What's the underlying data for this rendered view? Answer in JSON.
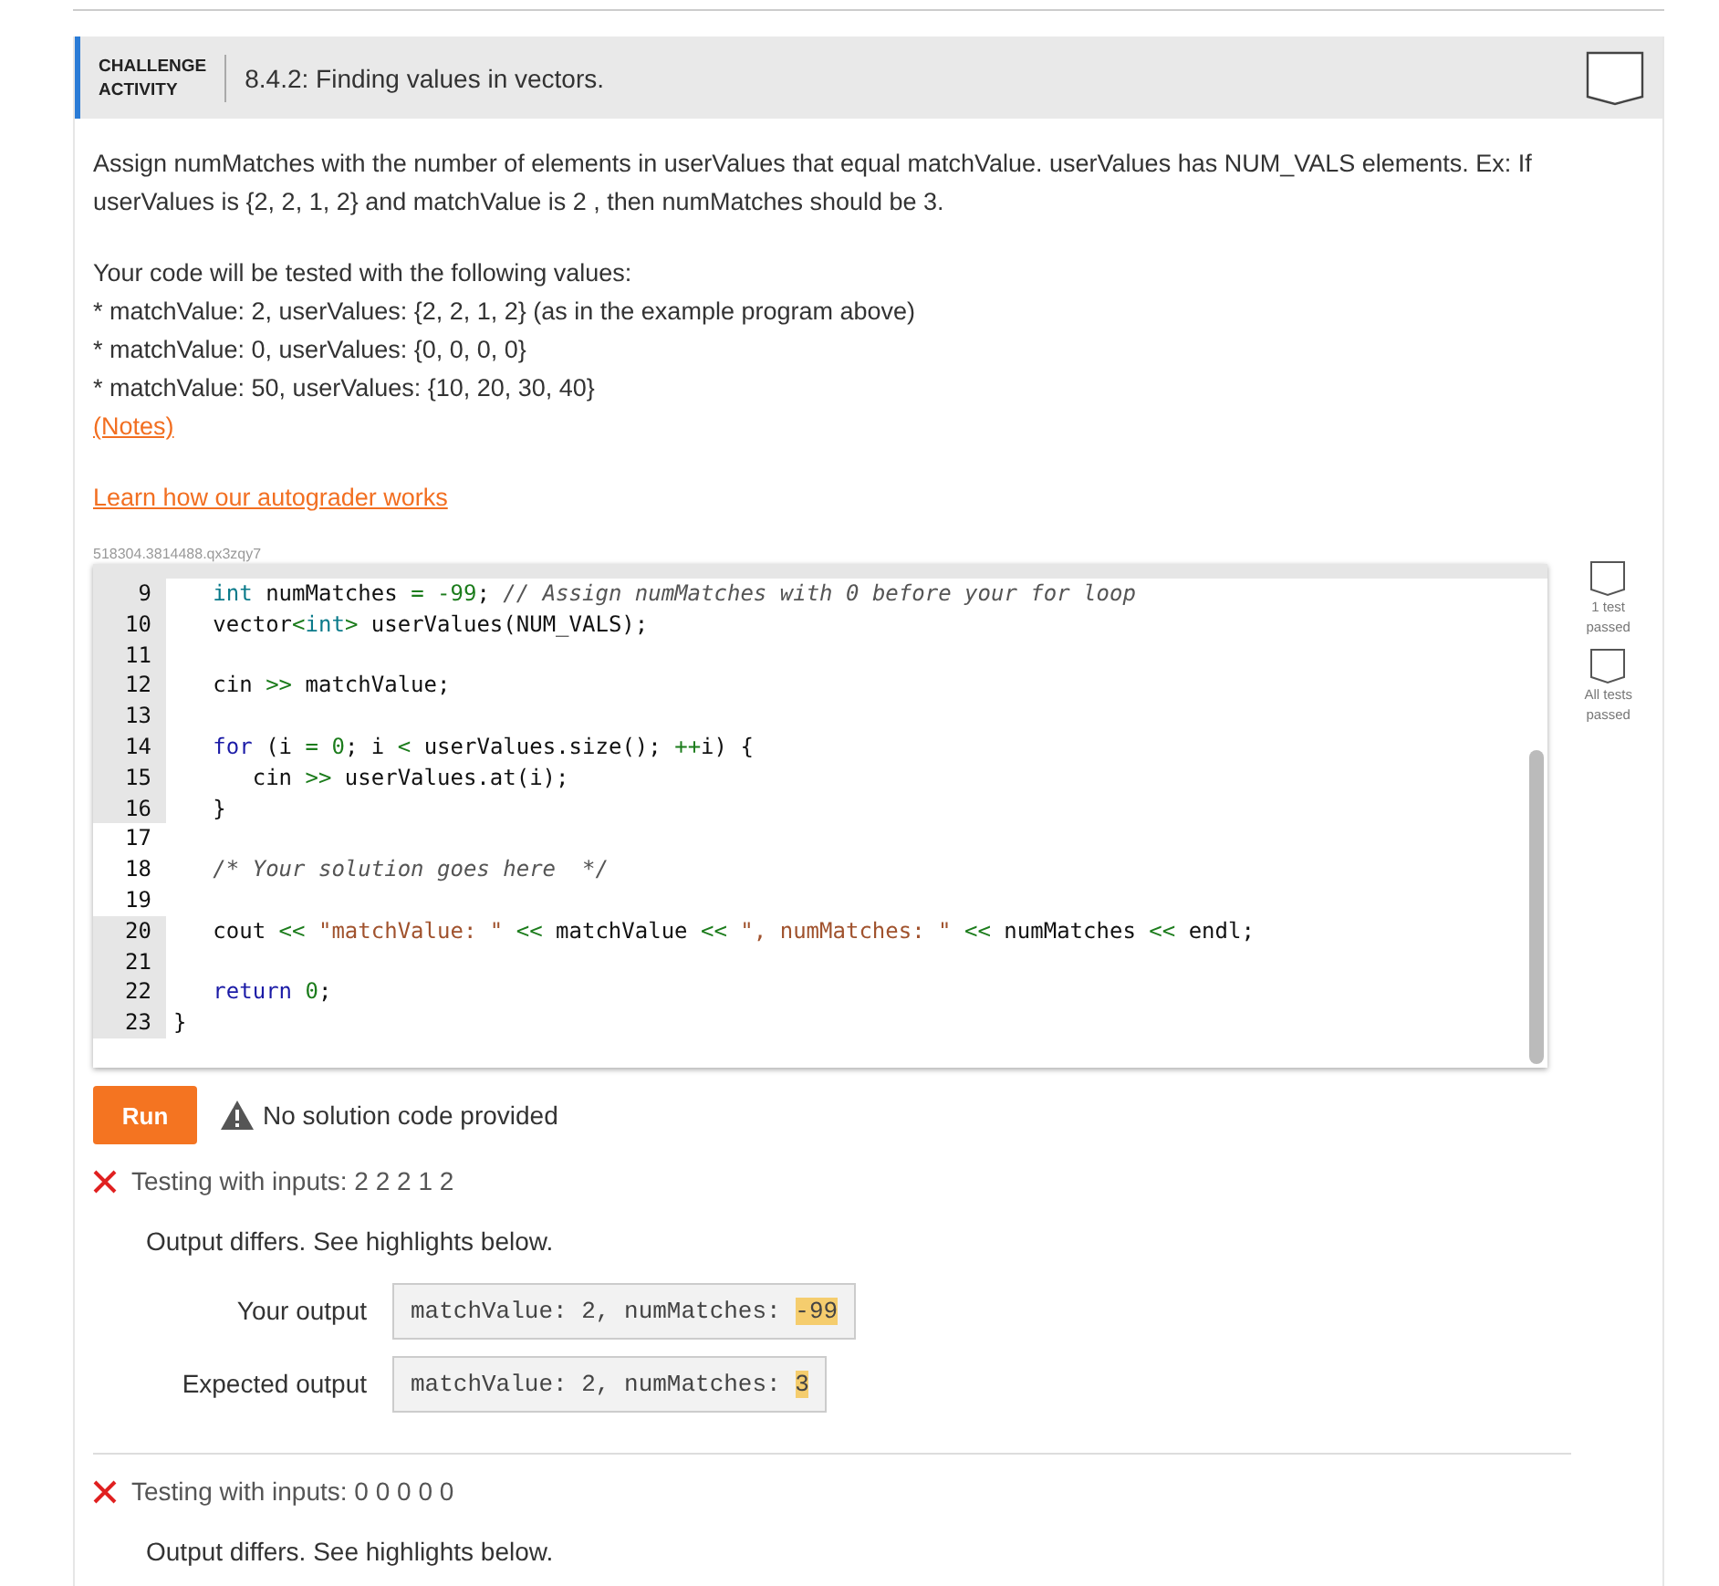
{
  "header": {
    "label_line1": "CHALLENGE",
    "label_line2": "ACTIVITY",
    "title": "8.4.2: Finding values in vectors."
  },
  "instructions": [
    "Assign numMatches with the number of elements in userValues that equal matchValue. userValues has NUM_VALS elements. Ex: If userValues is {2, 2, 1, 2} and matchValue is 2 , then numMatches should be 3."
  ],
  "tests_intro": "Your code will be tested with the following values:",
  "test_values": [
    "* matchValue: 2, userValues: {2, 2, 1, 2} (as in the example program above)",
    "* matchValue: 0, userValues: {0, 0, 0, 0}",
    "* matchValue: 50, userValues: {10, 20, 30, 40}"
  ],
  "notes_link": "(Notes)",
  "autograder_link": "Learn how our autograder works",
  "code_id": "518304.3814488.qx3zqy7",
  "code_lines": [
    {
      "number": "9",
      "editable": false,
      "tokens": [
        {
          "kind": "type",
          "text": "   int"
        },
        {
          "kind": "plain",
          "text": " numMatches "
        },
        {
          "kind": "op",
          "text": "="
        },
        {
          "kind": "number",
          "text": " -99"
        },
        {
          "kind": "plain",
          "text": "; "
        },
        {
          "kind": "comment",
          "text": "// Assign numMatches with 0 before your for loop"
        }
      ]
    },
    {
      "number": "10",
      "editable": false,
      "tokens": [
        {
          "kind": "plain",
          "text": "   vector"
        },
        {
          "kind": "op",
          "text": "<"
        },
        {
          "kind": "type",
          "text": "int"
        },
        {
          "kind": "op",
          "text": ">"
        },
        {
          "kind": "plain",
          "text": " userValues(NUM_VALS);"
        }
      ]
    },
    {
      "number": "11",
      "editable": false
    },
    {
      "number": "12",
      "editable": false,
      "tokens": [
        {
          "kind": "plain",
          "text": "   cin "
        },
        {
          "kind": "op",
          "text": ">>"
        },
        {
          "kind": "plain",
          "text": " matchValue;"
        }
      ]
    },
    {
      "number": "13",
      "editable": false
    },
    {
      "number": "14",
      "editable": false,
      "tokens": [
        {
          "kind": "keyword",
          "text": "   for"
        },
        {
          "kind": "plain",
          "text": " (i "
        },
        {
          "kind": "op",
          "text": "="
        },
        {
          "kind": "number",
          "text": " 0"
        },
        {
          "kind": "plain",
          "text": "; i "
        },
        {
          "kind": "op",
          "text": "<"
        },
        {
          "kind": "plain",
          "text": " userValues.size(); "
        },
        {
          "kind": "op",
          "text": "++"
        },
        {
          "kind": "plain",
          "text": "i) {"
        }
      ]
    },
    {
      "number": "15",
      "editable": false,
      "tokens": [
        {
          "kind": "plain",
          "text": "      cin "
        },
        {
          "kind": "op",
          "text": ">>"
        },
        {
          "kind": "plain",
          "text": " userValues.at(i);"
        }
      ]
    },
    {
      "number": "16",
      "editable": false,
      "tokens": [
        {
          "kind": "plain",
          "text": "   }"
        }
      ]
    },
    {
      "number": "17",
      "editable": true
    },
    {
      "number": "18",
      "editable": true,
      "tokens": [
        {
          "kind": "comment",
          "text": "   /* Your solution goes here  */"
        }
      ]
    },
    {
      "number": "19",
      "editable": true
    },
    {
      "number": "20",
      "editable": false,
      "tokens": [
        {
          "kind": "plain",
          "text": "   cout "
        },
        {
          "kind": "op",
          "text": "<<"
        },
        {
          "kind": "string",
          "text": " \"matchValue: \" "
        },
        {
          "kind": "op",
          "text": "<<"
        },
        {
          "kind": "plain",
          "text": " matchValue "
        },
        {
          "kind": "op",
          "text": "<<"
        },
        {
          "kind": "string",
          "text": " \", numMatches: \" "
        },
        {
          "kind": "op",
          "text": "<<"
        },
        {
          "kind": "plain",
          "text": " numMatches "
        },
        {
          "kind": "op",
          "text": "<<"
        },
        {
          "kind": "plain",
          "text": " endl;"
        }
      ]
    },
    {
      "number": "21",
      "editable": false
    },
    {
      "number": "22",
      "editable": false,
      "tokens": [
        {
          "kind": "keyword",
          "text": "   return"
        },
        {
          "kind": "number",
          "text": " 0"
        },
        {
          "kind": "plain",
          "text": ";"
        }
      ]
    },
    {
      "number": "23",
      "editable": false,
      "tokens": [
        {
          "kind": "plain",
          "text": "}"
        }
      ]
    }
  ],
  "progress": [
    {
      "label": "1 test passed",
      "done": false
    },
    {
      "label": "All tests passed",
      "done": false
    }
  ],
  "run_button": "Run",
  "run_message": "No solution code provided",
  "results": [
    {
      "passed": false,
      "title": "Testing with inputs: 2 2 2 1 2",
      "message": "Output differs. See highlights below.",
      "outputs": [
        {
          "label": "Your output",
          "parts": [
            {
              "text": "matchValue: 2, numMatches: ",
              "highlight": false
            },
            {
              "text": "-99",
              "highlight": true
            }
          ]
        },
        {
          "label": "Expected output",
          "parts": [
            {
              "text": "matchValue: 2, numMatches: ",
              "highlight": false
            },
            {
              "text": "3",
              "highlight": true
            }
          ]
        }
      ]
    },
    {
      "passed": false,
      "title": "Testing with inputs: 0 0 0 0 0",
      "message": "Output differs. See highlights below."
    }
  ]
}
